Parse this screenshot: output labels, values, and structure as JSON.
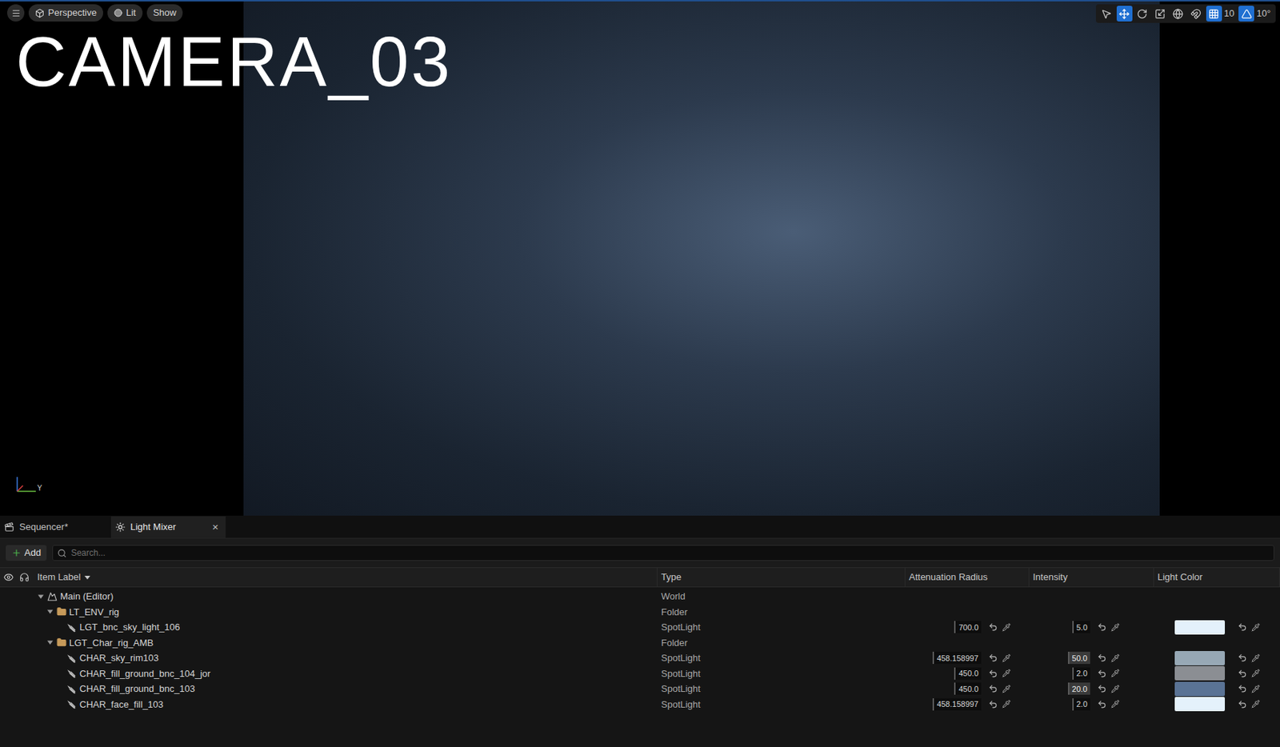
{
  "viewport": {
    "label": "CAMERA_03",
    "axis_label": "Y",
    "toolbar_left": [
      {
        "label": "Perspective",
        "icon": "box"
      },
      {
        "label": "Lit",
        "icon": "circle"
      },
      {
        "label": "Show",
        "icon": "none"
      }
    ],
    "tools": [
      {
        "icon": "select",
        "selected": false
      },
      {
        "icon": "move",
        "selected": true
      },
      {
        "icon": "rotate",
        "selected": false
      },
      {
        "icon": "scale",
        "selected": false
      },
      {
        "icon": "world",
        "selected": false
      },
      {
        "icon": "surface",
        "selected": false
      },
      {
        "icon": "grid",
        "selected": true,
        "value": "10"
      },
      {
        "icon": "angle",
        "selected": true,
        "value": "10°"
      }
    ]
  },
  "tabs": [
    {
      "label": "Sequencer*",
      "selected": false,
      "closable": false,
      "icon": "sequencer"
    },
    {
      "label": "Light Mixer",
      "selected": true,
      "closable": true,
      "icon": "light"
    }
  ],
  "close_glyph": "×",
  "toolbar": {
    "add": "Add",
    "search_placeholder": "Search..."
  },
  "columns": [
    "Item Label",
    "Type",
    "Attenuation Radius",
    "Intensity",
    "Light Color"
  ],
  "rows": [
    {
      "label": "Main (Editor)",
      "type": "World",
      "kind": "world",
      "depth": 0,
      "expanded": true
    },
    {
      "label": "LT_ENV_rig",
      "type": "Folder",
      "kind": "folder",
      "depth": 1,
      "expanded": true
    },
    {
      "label": "LGT_bnc_sky_light_106",
      "type": "SpotLight",
      "kind": "light",
      "depth": 2,
      "attenuation": "700.0",
      "intensity": "5.0",
      "intensity_modified": false,
      "color": "#e4f1fb"
    },
    {
      "label": "LGT_Char_rig_AMB",
      "type": "Folder",
      "kind": "folder",
      "depth": 1,
      "expanded": true
    },
    {
      "label": "CHAR_sky_rim103",
      "type": "SpotLight",
      "kind": "light",
      "depth": 2,
      "attenuation": "458.158997",
      "intensity": "50.0",
      "intensity_modified": true,
      "color": "#97a8b5"
    },
    {
      "label": "CHAR_fill_ground_bnc_104_jor",
      "type": "SpotLight",
      "kind": "light",
      "depth": 2,
      "attenuation": "450.0",
      "intensity": "2.0",
      "intensity_modified": false,
      "color": "#8b8e93"
    },
    {
      "label": "CHAR_fill_ground_bnc_103",
      "type": "SpotLight",
      "kind": "light",
      "depth": 2,
      "attenuation": "450.0",
      "intensity": "20.0",
      "intensity_modified": true,
      "color": "#5a7395"
    },
    {
      "label": "CHAR_face_fill_103",
      "type": "SpotLight",
      "kind": "light",
      "depth": 2,
      "attenuation": "458.158997",
      "intensity": "2.0",
      "intensity_modified": false,
      "color": "#e4f1fb"
    }
  ]
}
